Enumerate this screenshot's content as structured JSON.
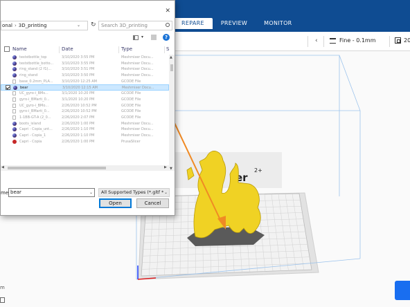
{
  "cura": {
    "tabs": [
      {
        "label": "REPARE",
        "active": true
      },
      {
        "label": "PREVIEW",
        "active": false
      },
      {
        "label": "MONITOR",
        "active": false
      }
    ],
    "profile_label": "Fine - 0.1mm",
    "infill_label": "20",
    "corner_text": "m",
    "logo_text": "er",
    "logo_sup": "2+",
    "colors": {
      "topbar": "#0f4c92",
      "slice_button": "#196ef0",
      "model": "#f0d224",
      "arrow": "#f08a24"
    }
  },
  "dialog": {
    "address": {
      "prefix": "onal",
      "folder": "3D_printing"
    },
    "search_placeholder": "Search 3D_printing",
    "help_glyph": "?",
    "columns": {
      "name": "Name",
      "date": "Date",
      "type": "Type",
      "size": "S"
    },
    "rows": [
      {
        "name": "teststbottle_top",
        "date": "3/10/2020 3:55 PM",
        "type": "Meshmixer Docu...",
        "icon": "model",
        "selected": false
      },
      {
        "name": "teststbottle_botto...",
        "date": "3/10/2020 3:55 PM",
        "type": "Meshmixer Docu...",
        "icon": "model",
        "selected": false
      },
      {
        "name": "ring_stand (2 f1)...",
        "date": "3/10/2020 3:51 PM",
        "type": "Meshmixer Docu...",
        "icon": "model",
        "selected": false
      },
      {
        "name": "ring_stand",
        "date": "3/10/2020 3:50 PM",
        "type": "Meshmixer Docu...",
        "icon": "model",
        "selected": false
      },
      {
        "name": "base_0.2mm_PLA...",
        "date": "3/10/2020 12:25 AM",
        "type": "GCODE File",
        "icon": "file",
        "selected": false
      },
      {
        "name": "bear",
        "date": "3/10/2020 12:15 AM",
        "type": "Meshmixer Docu...",
        "icon": "model",
        "selected": true
      },
      {
        "name": "UC_gyro-i_BMs...",
        "date": "3/1/2020 10:20 PM",
        "type": "GCODE File",
        "icon": "file",
        "selected": false
      },
      {
        "name": "gyro-i_BMarti_0...",
        "date": "3/1/2020 10:20 PM",
        "type": "GCODE File",
        "icon": "file",
        "selected": false
      },
      {
        "name": "UC_gyro-i_BMo...",
        "date": "2/26/2020 10:52 PM",
        "type": "GCODE File",
        "icon": "file",
        "selected": false
      },
      {
        "name": "gyro-i_BMarti_0...",
        "date": "2/26/2020 10:52 PM",
        "type": "GCODE File",
        "icon": "file",
        "selected": false
      },
      {
        "name": "1-1BB-GT-A (2_0...",
        "date": "2/26/2020 2:07 PM",
        "type": "GCODE File",
        "icon": "file",
        "selected": false
      },
      {
        "name": "boots_island",
        "date": "2/26/2020 1:00 PM",
        "type": "Meshmixer Docu...",
        "icon": "model",
        "selected": false
      },
      {
        "name": "Capri - Copia_unt...",
        "date": "2/26/2020 1:10 PM",
        "type": "Meshmixer Docu...",
        "icon": "model",
        "selected": false
      },
      {
        "name": "Capri - Copia_1",
        "date": "2/26/2020 1:10 PM",
        "type": "Meshmixer Docu...",
        "icon": "model",
        "selected": false
      },
      {
        "name": "Capri - Copia",
        "date": "2/26/2020 1:00 PM",
        "type": "PrusaSlicer",
        "icon": "pdf",
        "selected": false
      }
    ],
    "filename_label": "me:",
    "filename_value": "bear",
    "filetype_value": "All Supported Types (*.gltf *.g",
    "open_label": "Open",
    "cancel_label": "Cancel"
  }
}
